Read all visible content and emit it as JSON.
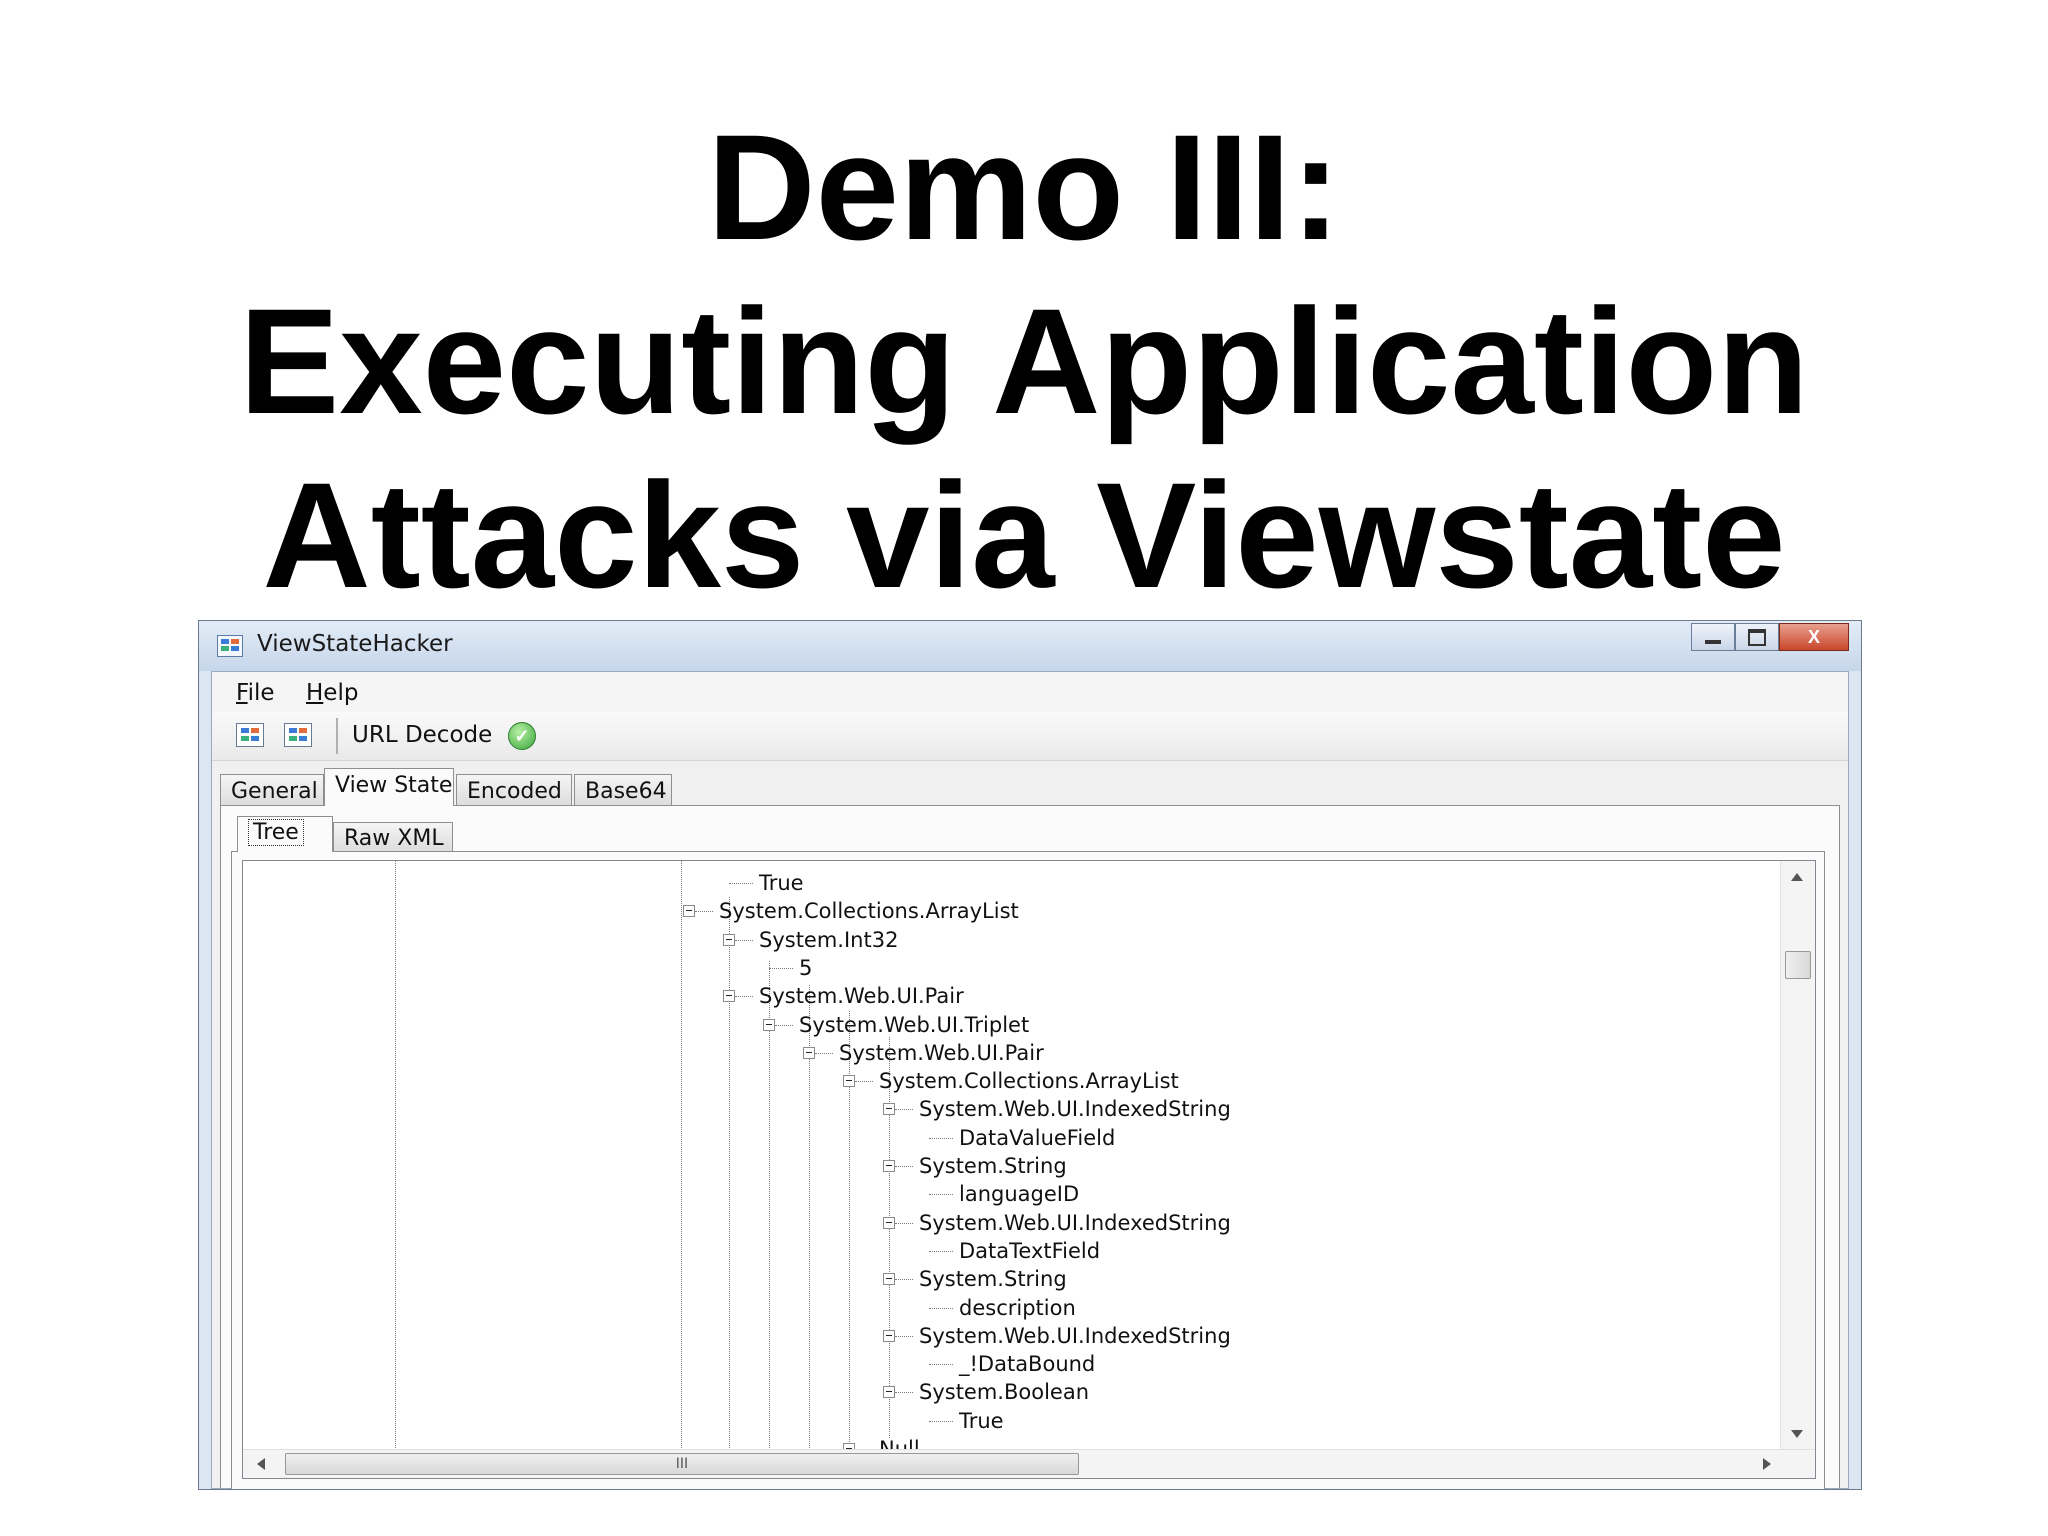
{
  "slide": {
    "title_lines": [
      "Demo III:",
      "Executing Application",
      "Attacks via Viewstate"
    ]
  },
  "window": {
    "title": "ViewStateHacker",
    "close_glyph": "X"
  },
  "menu": {
    "file": "File",
    "help": "Help"
  },
  "toolbar": {
    "url_decode_label": "URL Decode",
    "check_glyph": "✓"
  },
  "tabs": [
    "General",
    "View State",
    "Encoded",
    "Base64"
  ],
  "active_tab": "View State",
  "subtabs": [
    "Tree",
    "Raw XML"
  ],
  "active_subtab": "Tree",
  "tree": [
    "True",
    "System.Collections.ArrayList",
    "System.Int32",
    "5",
    "System.Web.UI.Pair",
    "System.Web.UI.Triplet",
    "System.Web.UI.Pair",
    "System.Collections.ArrayList",
    "System.Web.UI.IndexedString",
    "DataValueField",
    "System.String",
    "languageID",
    "System.Web.UI.IndexedString",
    "DataTextField",
    "System.String",
    "description",
    "System.Web.UI.IndexedString",
    "_!DataBound",
    "System.Boolean",
    "True",
    "Null"
  ],
  "hscroll_grip": "III"
}
